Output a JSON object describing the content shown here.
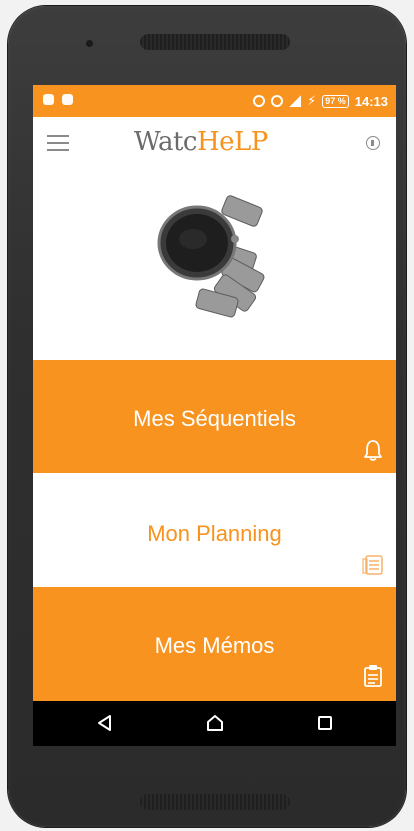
{
  "status_bar": {
    "battery_percent": "97 %",
    "time": "14:13"
  },
  "app_bar": {
    "logo_text_part1": "Watc",
    "logo_text_part2": "HeLP"
  },
  "tiles": [
    {
      "label": "Mes Séquentiels",
      "icon": "bell-icon"
    },
    {
      "label": "Mon Planning",
      "icon": "planning-icon"
    },
    {
      "label": "Mes Mémos",
      "icon": "memo-icon"
    }
  ],
  "nav": {
    "buttons": [
      "back",
      "home",
      "recents"
    ]
  },
  "colors": {
    "accent": "#f7931e",
    "nav_bg": "#000000",
    "phone_frame": "#2f2f2f"
  }
}
